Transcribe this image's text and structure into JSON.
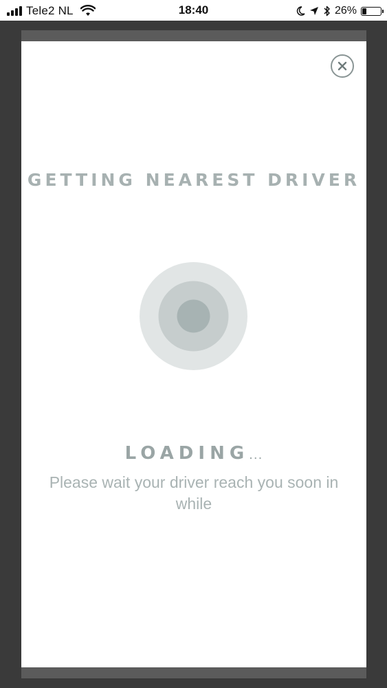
{
  "status_bar": {
    "carrier": "Tele2 NL",
    "time": "18:40",
    "battery_percent": "26%",
    "battery_level": 0.26,
    "icons": [
      "signal-icon",
      "wifi-icon",
      "moon-icon",
      "location-arrow-icon",
      "bluetooth-icon",
      "battery-icon"
    ]
  },
  "modal": {
    "title": "GETTING NEAREST DRIVER",
    "close_icon": "close-icon",
    "loading_label": "LOADING",
    "loading_dots": "...",
    "message": "Please wait your driver reach you soon in while"
  },
  "colors": {
    "overlay": "#3a3a3a",
    "card": "#ffffff",
    "muted_text": "#a7b1b1",
    "radar_outer": "#e1e5e5",
    "radar_middle": "#c6cdcd",
    "radar_inner": "#a7b3b3"
  }
}
